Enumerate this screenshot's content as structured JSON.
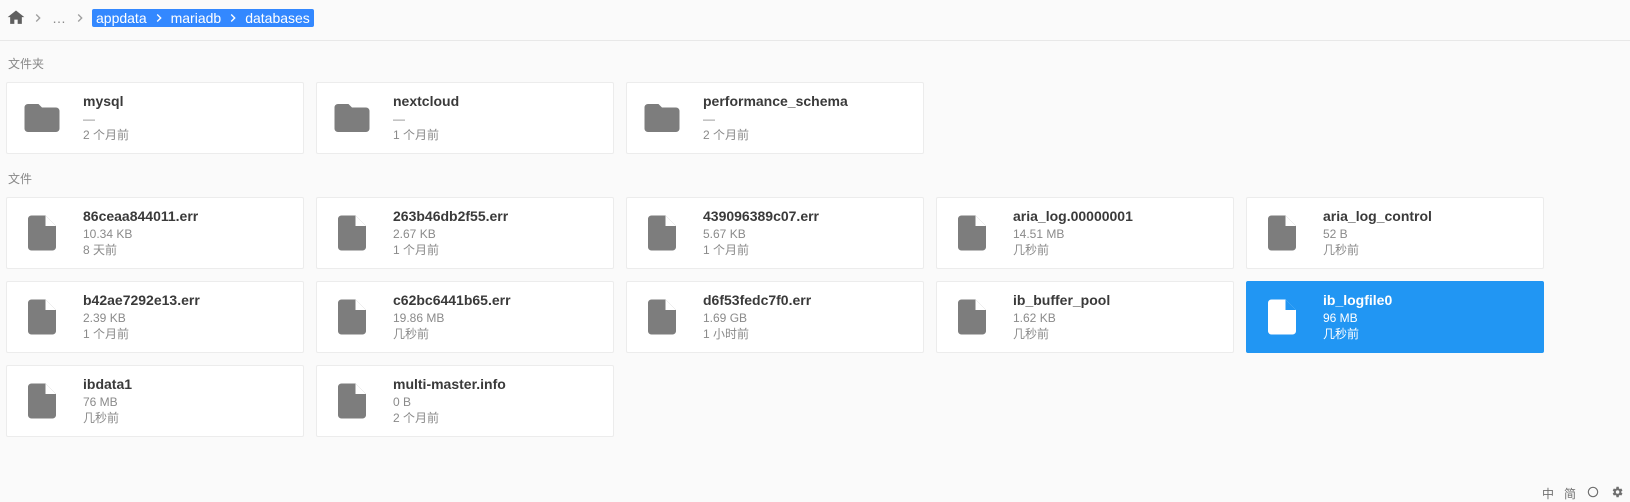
{
  "breadcrumb": {
    "ellipsis": "…",
    "segments": [
      "appdata",
      "mariadb",
      "databases"
    ]
  },
  "labels": {
    "folders": "文件夹",
    "files": "文件"
  },
  "folders": [
    {
      "name": "mysql",
      "size": "—",
      "time": "2 个月前"
    },
    {
      "name": "nextcloud",
      "size": "—",
      "time": "1 个月前"
    },
    {
      "name": "performance_schema",
      "size": "—",
      "time": "2 个月前"
    }
  ],
  "files": [
    {
      "name": "86ceaa844011.err",
      "size": "10.34 KB",
      "time": "8 天前",
      "selected": false
    },
    {
      "name": "263b46db2f55.err",
      "size": "2.67 KB",
      "time": "1 个月前",
      "selected": false
    },
    {
      "name": "439096389c07.err",
      "size": "5.67 KB",
      "time": "1 个月前",
      "selected": false
    },
    {
      "name": "aria_log.00000001",
      "size": "14.51 MB",
      "time": "几秒前",
      "selected": false
    },
    {
      "name": "aria_log_control",
      "size": "52 B",
      "time": "几秒前",
      "selected": false
    },
    {
      "name": "b42ae7292e13.err",
      "size": "2.39 KB",
      "time": "1 个月前",
      "selected": false
    },
    {
      "name": "c62bc6441b65.err",
      "size": "19.86 MB",
      "time": "几秒前",
      "selected": false
    },
    {
      "name": "d6f53fedc7f0.err",
      "size": "1.69 GB",
      "time": "1 小时前",
      "selected": false
    },
    {
      "name": "ib_buffer_pool",
      "size": "1.62 KB",
      "time": "几秒前",
      "selected": false
    },
    {
      "name": "ib_logfile0",
      "size": "96 MB",
      "time": "几秒前",
      "selected": true
    },
    {
      "name": "ibdata1",
      "size": "76 MB",
      "time": "几秒前",
      "selected": false
    },
    {
      "name": "multi-master.info",
      "size": "0 B",
      "time": "2 个月前",
      "selected": false
    }
  ],
  "systray": {
    "ime": "中",
    "ime2": "简"
  }
}
